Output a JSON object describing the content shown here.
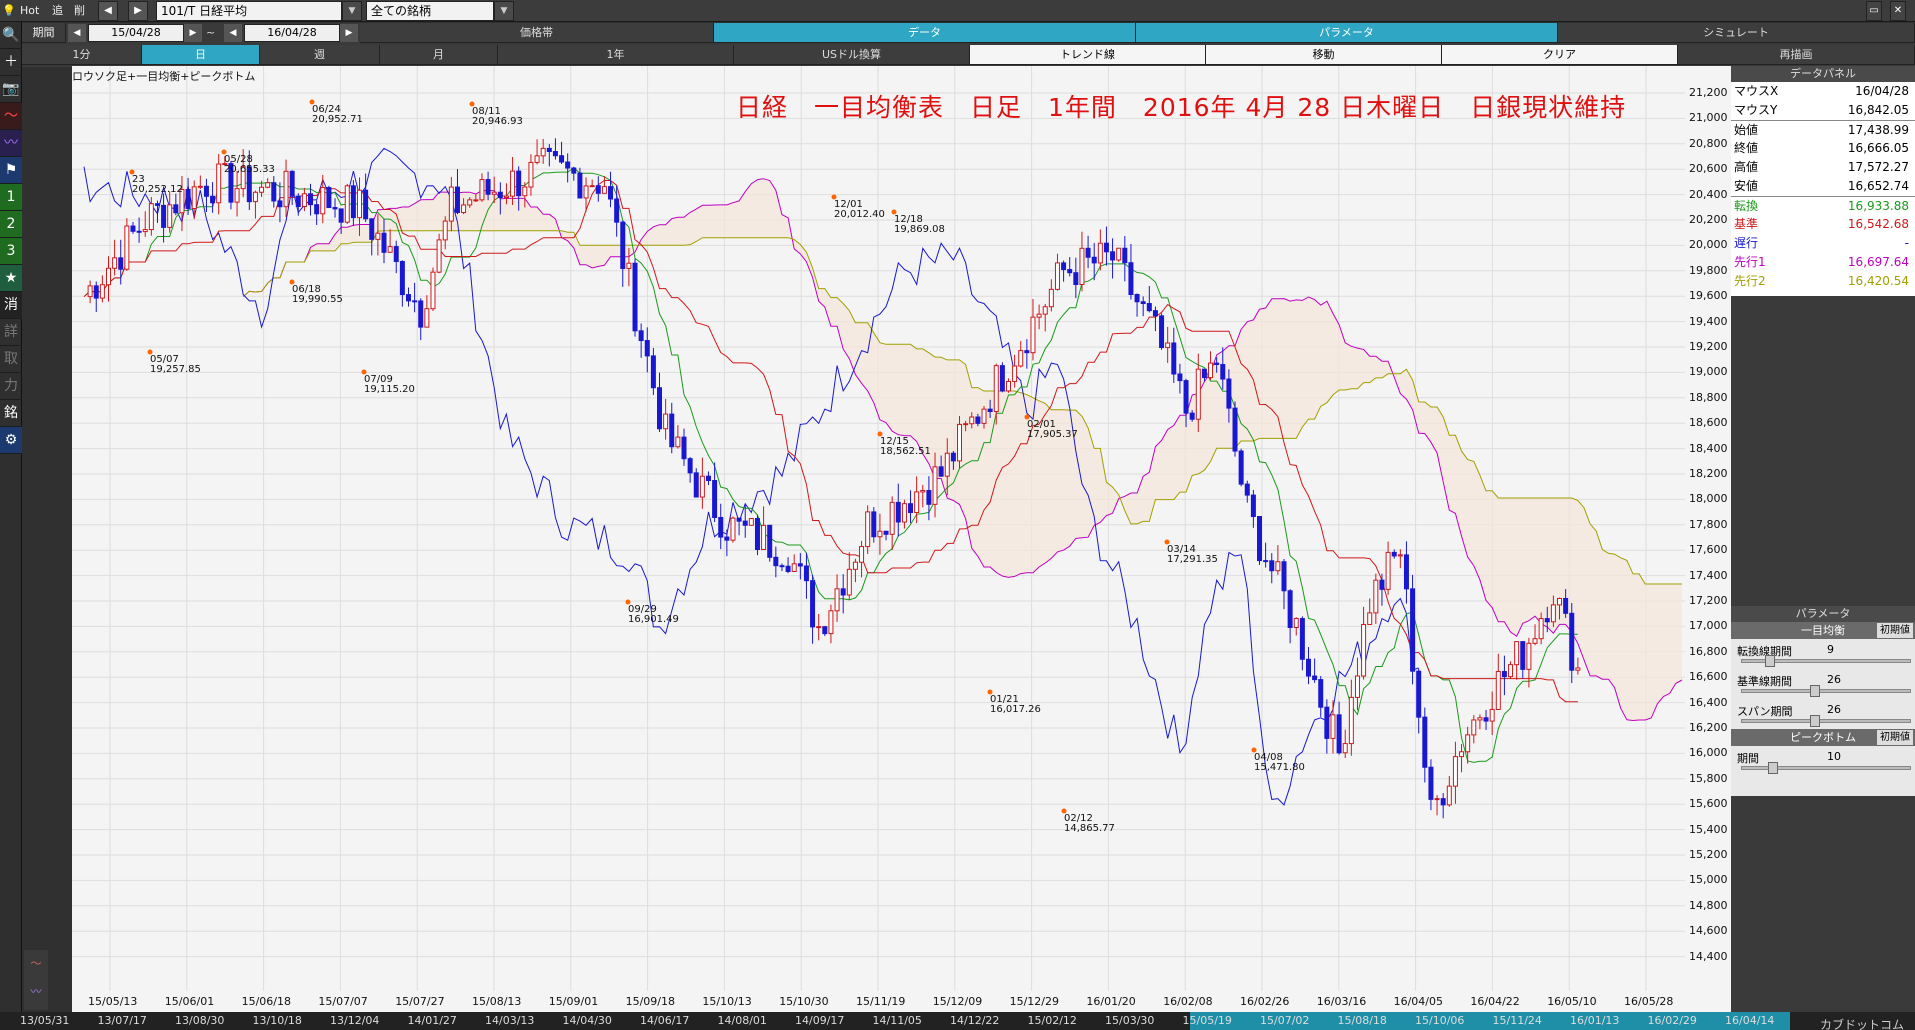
{
  "toolbar": {
    "hot": "Hot",
    "add": "追",
    "del": "削",
    "symbol": "101/T 日経平均",
    "filter": "全ての銘柄",
    "period_label": "期間",
    "date_from": "15/04/28",
    "date_to": "16/04/28",
    "tilde": "~",
    "tabs": [
      "価格帯",
      "データ",
      "パラメータ",
      "シミュレート"
    ],
    "intervals": [
      "1分",
      "日",
      "週",
      "月",
      "1年"
    ],
    "buttons": [
      "USドル換算",
      "トレンド線",
      "移動",
      "クリア",
      "再描画"
    ]
  },
  "sidebar": [
    "＋",
    "📷",
    "〜",
    "〰",
    "⚑",
    "1",
    "2",
    "3",
    "★",
    "消",
    "詳",
    "取",
    "力",
    "銘",
    "⚙"
  ],
  "chart": {
    "subtitle": "ロウソク足+一目均衡+ピークボトム",
    "title": "日経　一目均衡表　日足　1年間　2016年 4月 28 日木曜日　日銀現状維持"
  },
  "data_panel": {
    "header": "データパネル",
    "rows": [
      {
        "k": "マウスX",
        "v": "16/04/28",
        "c": "#000000"
      },
      {
        "k": "マウスY",
        "v": "16,842.05",
        "c": "#000000"
      },
      {
        "k": "始値",
        "v": "17,438.99",
        "c": "#000000"
      },
      {
        "k": "終値",
        "v": "16,666.05",
        "c": "#000000"
      },
      {
        "k": "高値",
        "v": "17,572.27",
        "c": "#000000"
      },
      {
        "k": "安値",
        "v": "16,652.74",
        "c": "#000000"
      },
      {
        "k": "転換",
        "v": "16,933.88",
        "c": "#1a9a1a"
      },
      {
        "k": "基準",
        "v": "16,542.68",
        "c": "#d01818"
      },
      {
        "k": "遅行",
        "v": "-",
        "c": "#1818d0"
      },
      {
        "k": "先行1",
        "v": "16,697.64",
        "c": "#c000c0"
      },
      {
        "k": "先行2",
        "v": "16,420.54",
        "c": "#a0a000"
      }
    ]
  },
  "param_panel": {
    "header": "パラメータ",
    "ichimoku": "一目均衡",
    "reset": "初期値",
    "peak": "ピークボトム",
    "rows": [
      {
        "label": "転換線期間",
        "value": "9"
      },
      {
        "label": "基準線期間",
        "value": "26"
      },
      {
        "label": "スパン期間",
        "value": "26"
      }
    ],
    "peak_rows": [
      {
        "label": "期間",
        "value": "10"
      }
    ]
  },
  "chart_data": {
    "type": "candlestick",
    "yaxis": [
      "21,200",
      "21,000",
      "20,800",
      "20,600",
      "20,400",
      "20,200",
      "20,000",
      "19,800",
      "19,600",
      "19,400",
      "19,200",
      "19,000",
      "18,800",
      "18,600",
      "18,400",
      "18,200",
      "18,000",
      "17,800",
      "17,600",
      "17,400",
      "17,200",
      "17,000",
      "16,800",
      "16,600",
      "16,400",
      "16,200",
      "16,000",
      "15,800",
      "15,600",
      "15,400",
      "15,200",
      "15,000",
      "14,800",
      "14,600",
      "14,400"
    ],
    "xaxis": [
      "15/05/13",
      "15/06/01",
      "15/06/18",
      "15/07/07",
      "15/07/27",
      "15/08/13",
      "15/09/01",
      "15/09/18",
      "15/10/13",
      "15/10/30",
      "15/11/19",
      "15/12/09",
      "15/12/29",
      "16/01/20",
      "16/02/08",
      "16/02/26",
      "16/03/16",
      "16/04/05",
      "16/04/22",
      "16/05/10",
      "16/05/28"
    ],
    "annotations": [
      {
        "date": "05/07",
        "value": "19,257.85"
      },
      {
        "date": "05/28",
        "value": "20,655.33"
      },
      {
        "date": "06/24",
        "value": "20,952.71"
      },
      {
        "date": "06/18",
        "value": "19,990.55"
      },
      {
        "date": "07/09",
        "value": "19,115.20"
      },
      {
        "date": "08/11",
        "value": "20,946.93"
      },
      {
        "date": "09/29",
        "value": "16,901.49"
      },
      {
        "date": "12/01",
        "value": "20,012.40"
      },
      {
        "date": "12/18",
        "value": "19,869.08"
      },
      {
        "date": "12/15",
        "value": "18,562.51"
      },
      {
        "date": "01/21",
        "value": "16,017.26"
      },
      {
        "date": "02/01",
        "value": "17,905.37"
      },
      {
        "date": "02/12",
        "value": "14,865.77"
      },
      {
        "date": "03/14",
        "value": "17,291.35"
      },
      {
        "date": "04/08",
        "value": "15,471.80"
      },
      {
        "date": "23",
        "value": "20,252.12"
      }
    ]
  },
  "datebar": [
    "13/05/31",
    "13/07/17",
    "13/08/30",
    "13/10/18",
    "13/12/04",
    "14/01/27",
    "14/03/13",
    "14/04/30",
    "14/06/17",
    "14/08/01",
    "14/09/17",
    "14/11/05",
    "14/12/22",
    "15/02/12",
    "15/03/30",
    "15/05/19",
    "15/07/02",
    "15/08/18",
    "15/10/06",
    "15/11/24",
    "16/01/13",
    "16/02/29",
    "16/04/14"
  ],
  "logo": "カブドットコム証券"
}
